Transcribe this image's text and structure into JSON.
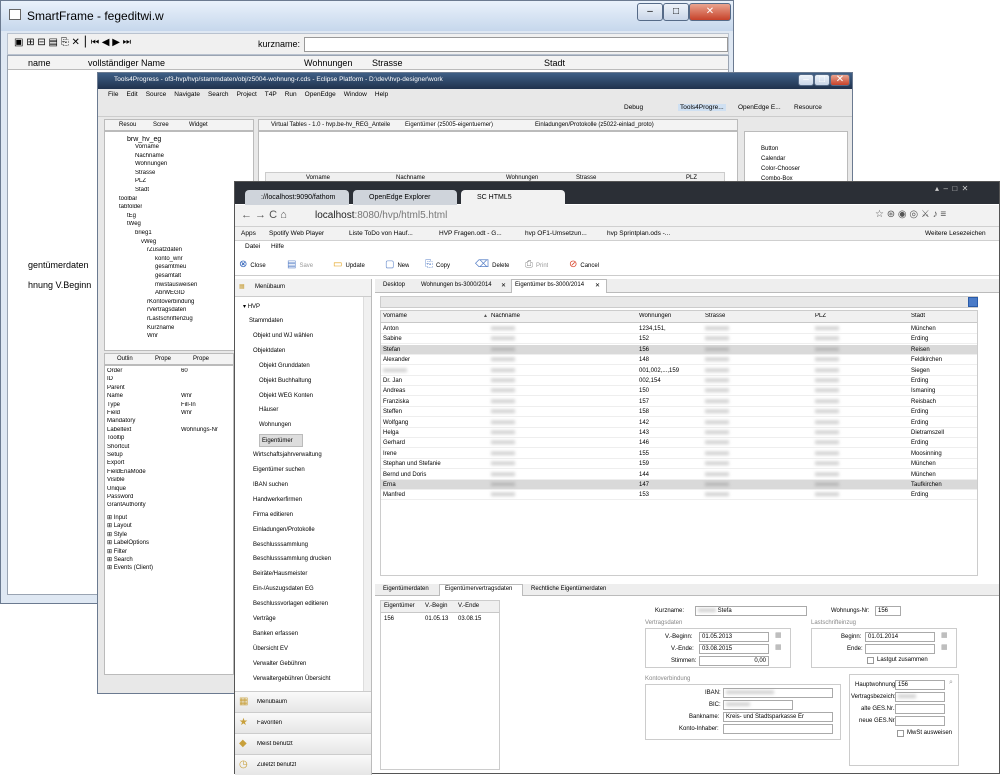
{
  "smartframe": {
    "title": "SmartFrame - fegeditwi.w",
    "kurzname_label": "kurzname:",
    "columns": [
      "name",
      "vollständiger Name",
      "Wohnungen",
      "Strasse",
      "Stadt"
    ],
    "label_eigentuemerdaten": "gentümerdaten",
    "label_wohnung_vbeginn": "hnung V.Beginn"
  },
  "eclipse": {
    "title": "Tools4Progress - of3-hvp/hvp/stammdaten/obj/z5004-wohnung-r.cds - Eclipse Platform - D:\\dev\\hvp-designer\\work",
    "menu": [
      "File",
      "Edit",
      "Source",
      "Navigate",
      "Search",
      "Project",
      "T4P",
      "Run",
      "OpenEdge",
      "Window",
      "Help"
    ],
    "editor_tabs": [
      "Virtual Tables - 1.0 - hvp.be-hv_REG_Anteile",
      "Eigentümer (z5005-eigentuemer)",
      "Einladungen/Protokolle (z5022-einlad_proto)"
    ],
    "left_tabs": [
      "Resou",
      "Scree",
      "Widget"
    ],
    "tree": [
      "Vorname",
      "Nachname",
      "Wohnungen",
      "Strasse",
      "PLZ",
      "Stadt",
      "toolbar",
      "tabfolder",
      "tEg",
      "tWeg",
      "brieg1",
      "vWeg",
      "rZusatzdaten",
      "konto_wnr",
      "gesamtmeu",
      "gesamtalt",
      "mwstausweisen",
      "AbrWEGID",
      "rKontoverbindung",
      "rVertragsdaten",
      "rLastschriftenzug",
      "Kurzname",
      "Wnr"
    ],
    "tree_head": "brw_hv_eg",
    "palette": [
      "Button",
      "Calendar",
      "Color-Chooser",
      "Combo-Box"
    ],
    "props_tabs": [
      "Outlin",
      "Prope",
      "Prope"
    ],
    "properties": [
      [
        "Order",
        "60"
      ],
      [
        "ID",
        ""
      ],
      [
        "Parent",
        ""
      ],
      [
        "Name",
        "Wnr"
      ],
      [
        "Type",
        "Fill-In"
      ],
      [
        "Field",
        "Wnr"
      ],
      [
        "Mandatory",
        ""
      ],
      [
        "Labeltext",
        "Wohnungs-Nr"
      ],
      [
        "Tooltip",
        ""
      ],
      [
        "Shortcut",
        ""
      ],
      [
        "Setup",
        ""
      ],
      [
        "Export",
        ""
      ],
      [
        "FieldEnaMode",
        ""
      ],
      [
        "Visible",
        ""
      ],
      [
        "Unique",
        ""
      ],
      [
        "Password",
        ""
      ],
      [
        "GrantAuthority",
        ""
      ]
    ],
    "prop_groups": [
      "Input",
      "Layout",
      "Style",
      "LabelOptions",
      "Filter",
      "Search",
      "Events (Client)"
    ],
    "grid_headers": [
      "Vorname",
      "Nachname",
      "Wohnungen",
      "Strasse",
      "PLZ"
    ],
    "toolbar_right": [
      "Debug",
      "Tools4Progre...",
      "OpenEdge E...",
      "Resource"
    ]
  },
  "browser": {
    "tabs": [
      "://localhost:9090/fathom",
      "OpenEdge Explorer",
      "SC HTML5"
    ],
    "url_host": "localhost",
    "url_rest": ":8080/hvp/html5.html",
    "bookmarks": [
      "Apps",
      "Spotify Web Player",
      "Liste ToDo von Hauf...",
      "HVP Fragen.odt - G...",
      "hvp OF1-Umsetzun...",
      "hvp Sprintplan.ods -..."
    ],
    "more_bookmarks": "Weitere Lesezeichen",
    "app_menu": [
      "Datei",
      "Hilfe"
    ],
    "toolbar": [
      "Close",
      "Save",
      "Update",
      "New",
      "Copy",
      "Delete",
      "Print",
      "Cancel"
    ],
    "nav": {
      "menubaum": "Menübaum",
      "hvp": "HVP",
      "items": [
        "Stammdaten",
        "Objekt und WJ wählen",
        "Objektdaten",
        "Objekt Grunddaten",
        "Objekt Buchhaltung",
        "Objekt WEG Konten",
        "Häuser",
        "Wohnungen",
        "Eigentümer",
        "Wirtschaftsjahrverwaltung",
        "Eigentümer suchen",
        "IBAN suchen",
        "Handwerkerfirmen",
        "Firma editieren",
        "Einladungen/Protokolle",
        "Beschlusssammlung",
        "Beschlusssammlung drucken",
        "Beiräte/Hausmeister",
        "Ein-/Auszugsdaten EG",
        "Beschlussvorlagen editieren",
        "Verträge",
        "Banken erfassen",
        "Übersicht EV",
        "Verwalter Gebühren",
        "Verwaltergebühren Übersicht"
      ],
      "bottom": [
        "Menübaum",
        "Favoriten",
        "Meist benutzt",
        "Zuletzt benutzt"
      ]
    },
    "content_tabs": [
      "Desktop",
      "Wohnungen bs-3000/2014",
      "Eigentümer bs-3000/2014"
    ],
    "grid": {
      "headers": [
        "Vorname",
        "Nachname",
        "Wohnungen",
        "Strasse",
        "PLZ",
        "Stadt"
      ],
      "rows": [
        [
          "Anton",
          "",
          "1234,151,",
          "",
          "",
          "München"
        ],
        [
          "Sabine",
          "",
          "152",
          "",
          "",
          "Erding"
        ],
        [
          "Stefan",
          "",
          "156",
          "",
          "",
          "Reisen"
        ],
        [
          "Alexander",
          "",
          "148",
          "",
          "",
          "Feldkirchen"
        ],
        [
          "",
          "",
          "001,002,...,159",
          "",
          "",
          "Siegen"
        ],
        [
          "Dr. Jan",
          "",
          "002,154",
          "",
          "",
          "Erding"
        ],
        [
          "Andreas",
          "",
          "150",
          "",
          "",
          "Ismaning"
        ],
        [
          "Franziska",
          "",
          "157",
          "",
          "",
          "Reisbach"
        ],
        [
          "Steffen",
          "",
          "158",
          "",
          "",
          "Erding"
        ],
        [
          "Wolfgang",
          "",
          "142",
          "",
          "",
          "Erding"
        ],
        [
          "Helga",
          "",
          "143",
          "",
          "",
          "Dietramszell"
        ],
        [
          "Gerhard",
          "",
          "146",
          "",
          "",
          "Erding"
        ],
        [
          "Irene",
          "",
          "155",
          "",
          "",
          "Moosinning"
        ],
        [
          "Stephan und Stefanie",
          "",
          "159",
          "",
          "",
          "München"
        ],
        [
          "Bernd und Doris",
          "",
          "144",
          "",
          "",
          "München"
        ],
        [
          "Erna",
          "",
          "147",
          "",
          "",
          "Taufkirchen"
        ],
        [
          "Manfred",
          "",
          "153",
          "",
          "",
          "Erding"
        ]
      ]
    },
    "detail_tabs": [
      "Eigentümerdaten",
      "Eigentümervertragsdaten",
      "Rechtliche Eigentümerdaten"
    ],
    "detail_grid": {
      "headers": [
        "Eigentümer",
        "V.-Begin",
        "V.-Ende"
      ],
      "row": [
        "156",
        "01.05.13",
        "03.08.15"
      ]
    },
    "form": {
      "kurzname_label": "Kurzname:",
      "kurzname_value": "Stefa",
      "wohnungsnr_label": "Wohnungs-Nr:",
      "wohnungsnr_value": "156",
      "vertragsdaten": "Vertragsdaten",
      "lastschrifteinzug": "Lastschrifteinzug",
      "vbeginn_label": "V.-Beginn:",
      "vbeginn_value": "01.05.2013",
      "vende_label": "V.-Ende:",
      "vende_value": "03.08.2015",
      "stimmen_label": "Stimmen:",
      "stimmen_value": "0,00",
      "beginn_label": "Beginn:",
      "beginn_value": "01.01.2014",
      "ende_label": "Ende:",
      "lastgut_label": "Lastgut zusammen",
      "kontoverbindung": "Kontoverbindung",
      "iban_label": "IBAN:",
      "bic_label": "BIC:",
      "bankname_label": "Bankname:",
      "bankname_value": "Kreis- und Stadtsparkasse Er",
      "kontoinhaber_label": "Konto-Inhaber:",
      "hauptwohnung_label": "Hauptwohnung:",
      "hauptwohnung_value": "156",
      "vertragsbez_label": "Vertragsbezeich:",
      "alte_ges_label": "alte GES.Nr.:",
      "neue_ges_label": "neue GES.Nr.:",
      "mwst_label": "MwSt ausweisen"
    }
  }
}
